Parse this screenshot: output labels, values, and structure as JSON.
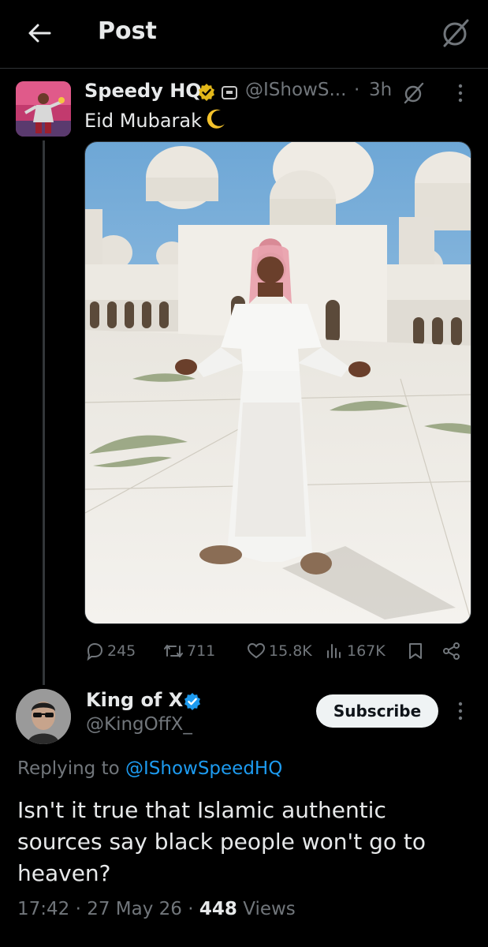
{
  "header": {
    "title": "Post",
    "back_icon": "arrow-left-icon",
    "grok_icon": "grok-icon"
  },
  "post": {
    "author_name": "Speedy HQ",
    "author_handle": "@IShowS...",
    "separator": "·",
    "time_ago": "3h",
    "text": "Eid Mubarak",
    "text_emoji": "crescent-moon-icon",
    "verified_color": "#e2b719",
    "image_alt": "Person in white thobe and red keffiyeh standing in front of a white domed mosque",
    "actions": {
      "replies": "245",
      "reposts": "711",
      "likes": "15.8K",
      "views": "167K"
    }
  },
  "reply": {
    "author_name": "King of X",
    "author_handle": "@KingOffX_",
    "verified_color": "#1d9bf0",
    "subscribe_label": "Subscribe",
    "replying_prefix": "Replying to",
    "replying_to": "@IShowSpeedHQ",
    "text": "Isn't it true that Islamic authentic sources say black people won't go to heaven?",
    "time": "17:42",
    "date": "27 May 26",
    "views_count": "448",
    "views_label": "Views",
    "separator": "·"
  },
  "colors": {
    "background": "#000000",
    "text": "#e7e9ea",
    "muted": "#71767b",
    "link": "#1d9bf0"
  }
}
